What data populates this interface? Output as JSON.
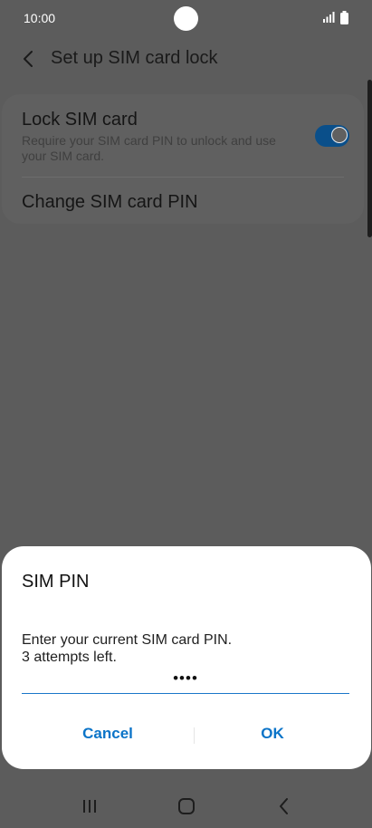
{
  "status_bar": {
    "time": "10:00",
    "icons": [
      "signal-icon",
      "battery-icon"
    ]
  },
  "header": {
    "back_icon": "back-arrow-icon",
    "title": "Set up SIM card lock"
  },
  "settings": {
    "lock_sim": {
      "title": "Lock SIM card",
      "subtitle": "Require your SIM card PIN to unlock and use your SIM card.",
      "enabled": true
    },
    "change_pin": {
      "title": "Change SIM card PIN"
    }
  },
  "dialog": {
    "title": "SIM PIN",
    "message_line1": "Enter your current SIM card PIN.",
    "message_line2": "3 attempts left.",
    "pin_value": "••••",
    "cancel_label": "Cancel",
    "ok_label": "OK"
  },
  "nav_bar": {
    "icons": [
      "recent-apps-icon",
      "home-icon",
      "back-icon"
    ]
  },
  "colors": {
    "accent": "#0b74c8",
    "toggle_on": "#0a4f8a",
    "scrim": "#5c5c5c"
  }
}
